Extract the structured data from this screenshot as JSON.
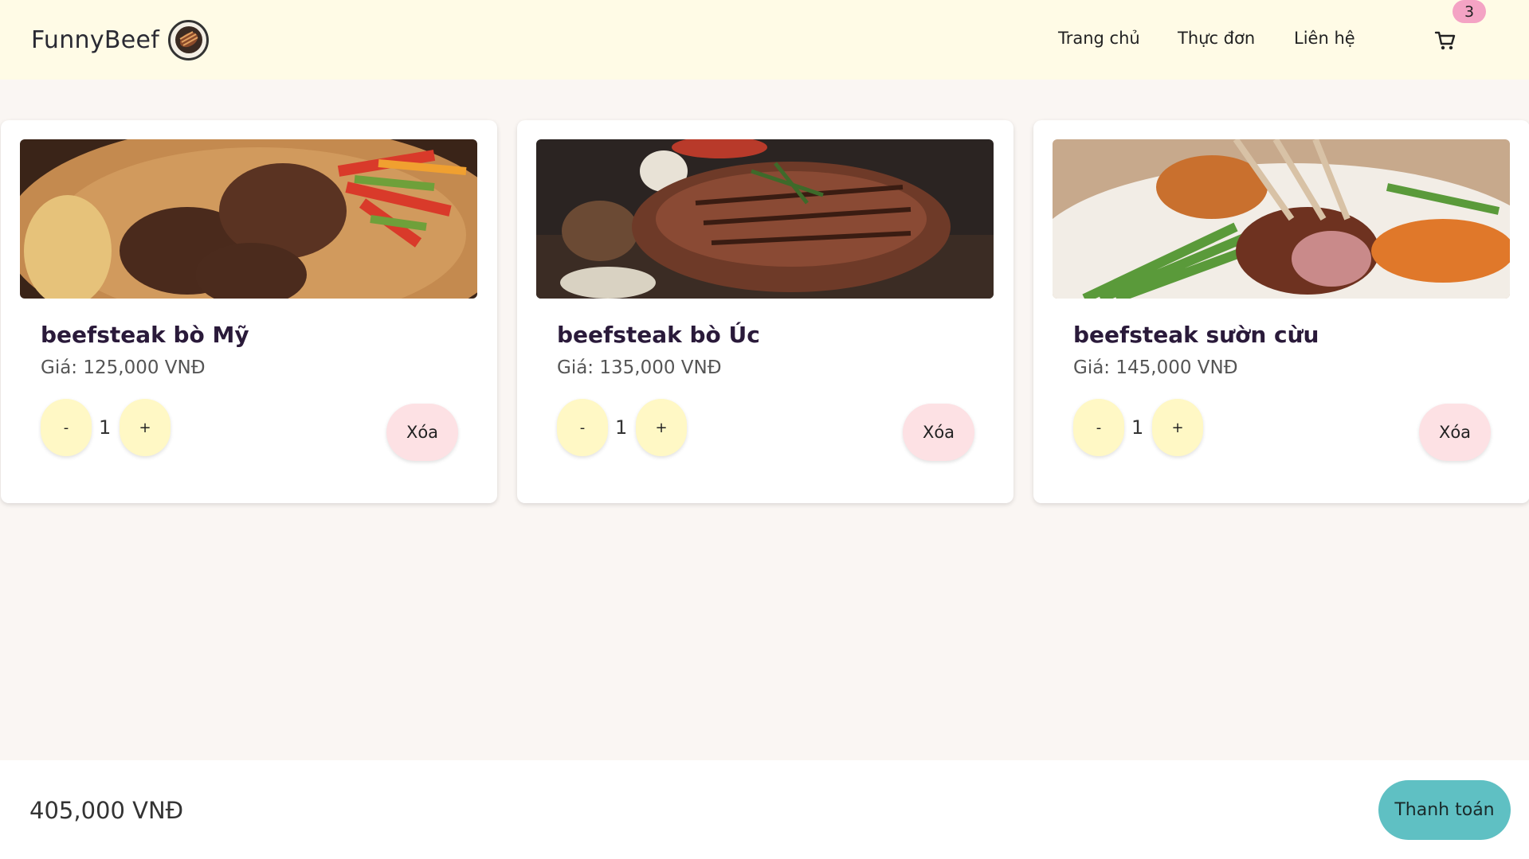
{
  "header": {
    "brand": "FunnyBeef",
    "nav": [
      "Trang chủ",
      "Thực đơn",
      "Liên hệ"
    ],
    "cart_count": "3"
  },
  "cart": {
    "items": [
      {
        "name": "beefsteak bò Mỹ",
        "price": "Giá: 125,000 VNĐ",
        "qty": "1",
        "dec": "-",
        "inc": "+",
        "remove": "Xóa",
        "image": "beef-steak-on-board-photo"
      },
      {
        "name": "beefsteak bò Úc",
        "price": "Giá: 135,000 VNĐ",
        "qty": "1",
        "dec": "-",
        "inc": "+",
        "remove": "Xóa",
        "image": "grilled-steak-photo"
      },
      {
        "name": "beefsteak sườn cừu",
        "price": "Giá: 145,000 VNĐ",
        "qty": "1",
        "dec": "-",
        "inc": "+",
        "remove": "Xóa",
        "image": "lamb-ribs-photo"
      }
    ],
    "total": "405,000 VNĐ",
    "checkout_label": "Thanh toán"
  },
  "colors": {
    "header_bg": "#fffbe6",
    "page_bg": "#faf6f3",
    "badge": "#f4a3c4",
    "qty_button": "#fff8c5",
    "remove_button": "#fde1e4",
    "checkout_button": "#5fc0c3"
  },
  "icons": [
    "cart-icon",
    "brand-logo-icon"
  ]
}
